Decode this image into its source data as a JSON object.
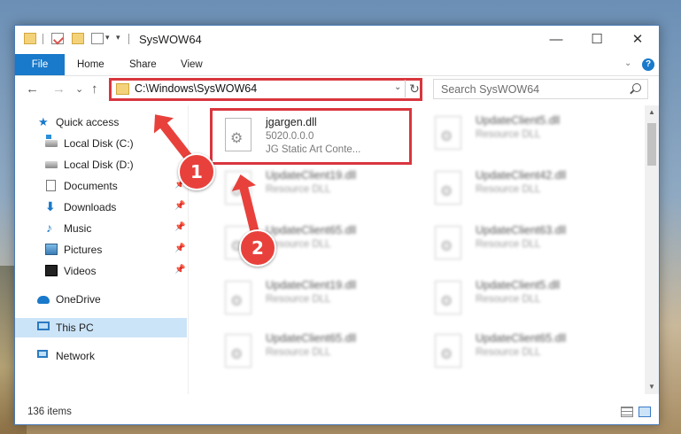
{
  "window": {
    "title": "SysWOW64",
    "minimize": "—",
    "maximize": "☐",
    "close": "✕"
  },
  "ribbon": {
    "tabs": [
      "File",
      "Home",
      "Share",
      "View"
    ],
    "help": "?"
  },
  "address": {
    "path": "C:\\Windows\\SysWOW64",
    "search_placeholder": "Search SysWOW64"
  },
  "nav": {
    "back": "←",
    "forward": "→",
    "recent": "⌄",
    "up": "↑",
    "refresh": "↻"
  },
  "sidebar": {
    "items": [
      {
        "label": "Quick access",
        "icon": "star-icon"
      },
      {
        "label": "Local Disk (C:)",
        "icon": "drive-c-icon"
      },
      {
        "label": "Local Disk (D:)",
        "icon": "drive-icon"
      },
      {
        "label": "Documents",
        "icon": "documents-icon"
      },
      {
        "label": "Downloads",
        "icon": "downloads-icon"
      },
      {
        "label": "Music",
        "icon": "music-icon"
      },
      {
        "label": "Pictures",
        "icon": "pictures-icon"
      },
      {
        "label": "Videos",
        "icon": "videos-icon"
      },
      {
        "label": "OneDrive",
        "icon": "onedrive-icon"
      },
      {
        "label": "This PC",
        "icon": "pc-icon",
        "selected": true
      },
      {
        "label": "Network",
        "icon": "network-icon"
      }
    ]
  },
  "files": [
    {
      "name": "jgargen.dll",
      "line2": "5020.0.0.0",
      "line3": "JG Static Art Conte...",
      "highlighted": true
    },
    {
      "name": "UpdateClient5.dll",
      "line2": "Resource DLL"
    },
    {
      "name": "UpdateClient19.dll",
      "line2": "Resource DLL"
    },
    {
      "name": "UpdateClient42.dll",
      "line2": "Resource DLL"
    },
    {
      "name": "UpdateClient65.dll",
      "line2": "Resource DLL"
    },
    {
      "name": "UpdateClient63.dll",
      "line2": "Resource DLL"
    },
    {
      "name": "UpdateClient19.dll",
      "line2": "Resource DLL"
    },
    {
      "name": "UpdateClient5.dll",
      "line2": "Resource DLL"
    },
    {
      "name": "UpdateClient65.dll",
      "line2": "Resource DLL"
    },
    {
      "name": "UpdateClient65.dll",
      "line2": "Resource DLL"
    }
  ],
  "status": {
    "item_count": "136 items"
  },
  "annotations": {
    "badge1": "1",
    "badge2": "2",
    "color": "#e8413c"
  }
}
